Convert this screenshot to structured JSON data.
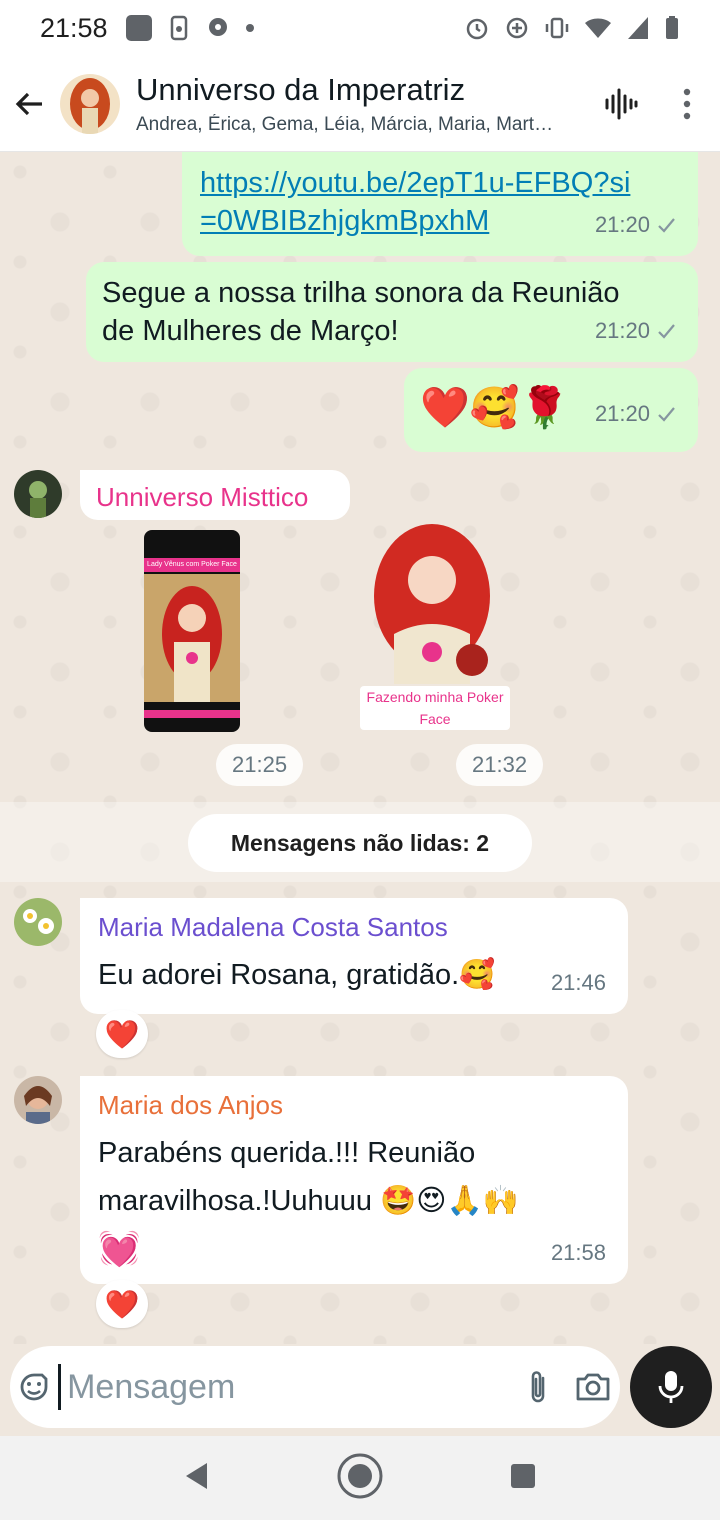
{
  "status_bar": {
    "time": "21:58"
  },
  "header": {
    "title": "Unniverso da Imperatriz",
    "subtitle": "Andrea, Érica, Gema, Léia, Márcia, Maria, Mart…"
  },
  "messages": {
    "m1": {
      "link": "https://youtu.be/2epT1u-EFBQ?si=0WBIBzhjgkmBpxhM",
      "link_line1": "https://youtu.be/2epT1u-EFBQ?si",
      "link_line2": "=0WBIBzhjgkmBpxhM",
      "time": "21:20"
    },
    "m2": {
      "line1": "Segue a nossa trilha sonora da Reunião",
      "line2": "de Mulheres de Março!",
      "time": "21:20"
    },
    "m3": {
      "text": "❤️🥰🌹",
      "time": "21:20"
    },
    "m4": {
      "sender": "Unniverso Misttico",
      "sticker1_caption": "Lady Vênus com Poker Face",
      "sticker1_time": "21:25",
      "sticker2_caption_line1": "Fazendo minha Poker",
      "sticker2_caption_line2": "Face",
      "sticker2_time": "21:32"
    },
    "unread_label": "Mensagens não lidas: 2",
    "m5": {
      "sender": "Maria Madalena Costa Santos",
      "text": "Eu adorei Rosana, gratidão.🥰",
      "time": "21:46",
      "reaction": "❤️"
    },
    "m6": {
      "sender": "Maria dos Anjos",
      "line1": "Parabéns querida.!!! Reunião",
      "line2": "maravilhosa.!Uuhuuu 🤩😍🙏🙌",
      "line3": "💓",
      "time": "21:58",
      "reaction": "❤️"
    }
  },
  "input": {
    "placeholder": "Mensagem"
  },
  "colors": {
    "outgoing": "#d9fdd3",
    "incoming": "#ffffff",
    "sender_pink": "#e8338b",
    "sender_purple": "#6b4fcf",
    "sender_orange": "#e8703a",
    "link": "#027eb5"
  },
  "icons": [
    "back-arrow-icon",
    "voice-wave-icon",
    "more-vert-icon",
    "emoji-sticker-icon",
    "paperclip-icon",
    "camera-icon",
    "mic-icon",
    "nav-back-icon",
    "nav-home-icon",
    "nav-recents-icon"
  ]
}
